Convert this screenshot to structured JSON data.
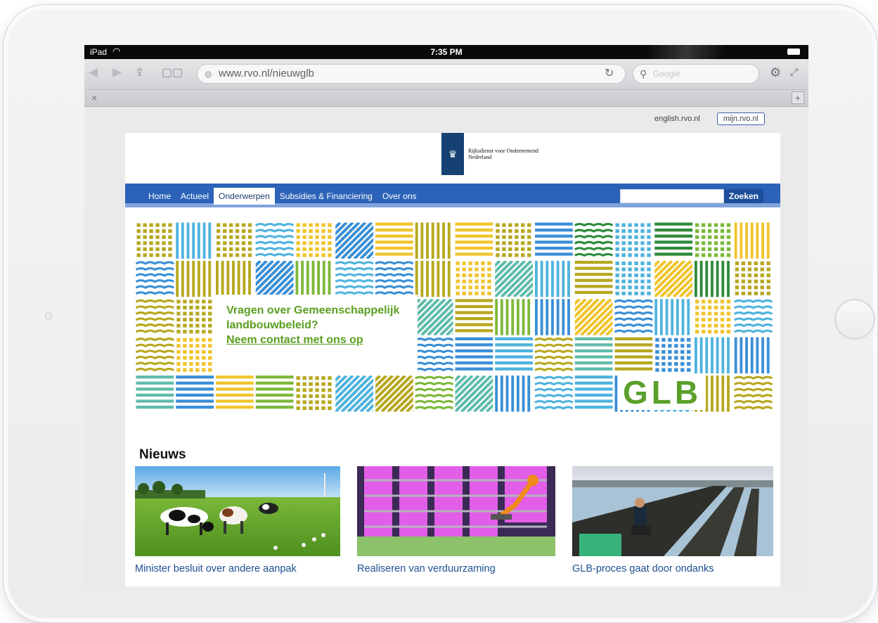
{
  "statusbar": {
    "carrier": "iPad",
    "time": "7:35 PM"
  },
  "browser": {
    "url": "www.rvo.nl/nieuwglb",
    "search_placeholder": "Google",
    "tab_close": "×",
    "tab_add": "+",
    "icons": [
      "back-icon",
      "forward-icon",
      "share-icon",
      "bookmarks-icon",
      "reload-icon",
      "search-icon",
      "gear-icon",
      "fullscreen-icon"
    ]
  },
  "site": {
    "toplinks": {
      "english": "english.rvo.nl",
      "mijn": "mijn.rvo.nl"
    },
    "logo": {
      "line1": "Rijksdienst voor Ondernemend",
      "line2": "Nederland"
    },
    "nav": {
      "items": [
        {
          "label": "Home"
        },
        {
          "label": "Actueel"
        },
        {
          "label": "Onderwerpen"
        },
        {
          "label": "Subsidies & Financiering"
        },
        {
          "label": "Over ons"
        }
      ],
      "active_index": 2,
      "search_button": "Zoeken"
    },
    "banner": {
      "question_line1": "Vragen over Gemeenschappelijk",
      "question_line2": "landbouwbeleid?",
      "link": "Neem contact met ons op",
      "logo_text": "GLB",
      "colors": [
        "#4fb3dd",
        "#3a8fd6",
        "#7db83a",
        "#b6a81e",
        "#f0c42b",
        "#5fbcaa",
        "#2f8a3a"
      ]
    },
    "news": {
      "heading": "Nieuws",
      "items": [
        {
          "title": "Minister besluit over andere aanpak"
        },
        {
          "title": "Realiseren van verduurzaming"
        },
        {
          "title": "GLB-proces gaat door ondanks"
        }
      ]
    }
  }
}
